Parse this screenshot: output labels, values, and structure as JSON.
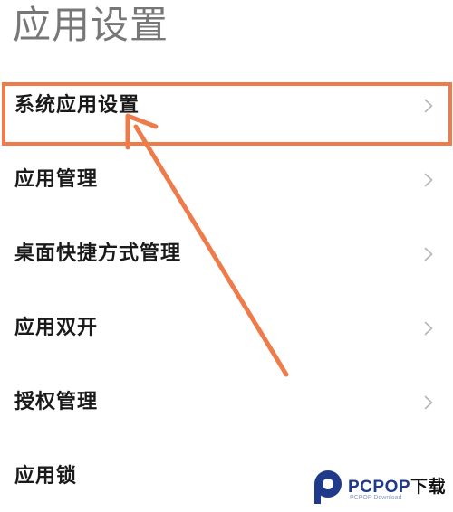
{
  "header": {
    "title": "应用设置"
  },
  "settings_list": {
    "items": [
      {
        "label": "系统应用设置"
      },
      {
        "label": "应用管理"
      },
      {
        "label": "桌面快捷方式管理"
      },
      {
        "label": "应用双开"
      },
      {
        "label": "授权管理"
      },
      {
        "label": "应用锁"
      }
    ]
  },
  "icons": {
    "chevron": "chevron-right-icon"
  },
  "colors": {
    "highlight": "#EE7B4A",
    "title_text": "#777777",
    "item_text": "#1a1a1a",
    "chevron": "#b5b5b5",
    "watermark_blue": "#1f3a8a"
  },
  "watermark": {
    "brand": "PCPOP",
    "brand_cn": "下载",
    "sub": "PCPOP Download"
  }
}
